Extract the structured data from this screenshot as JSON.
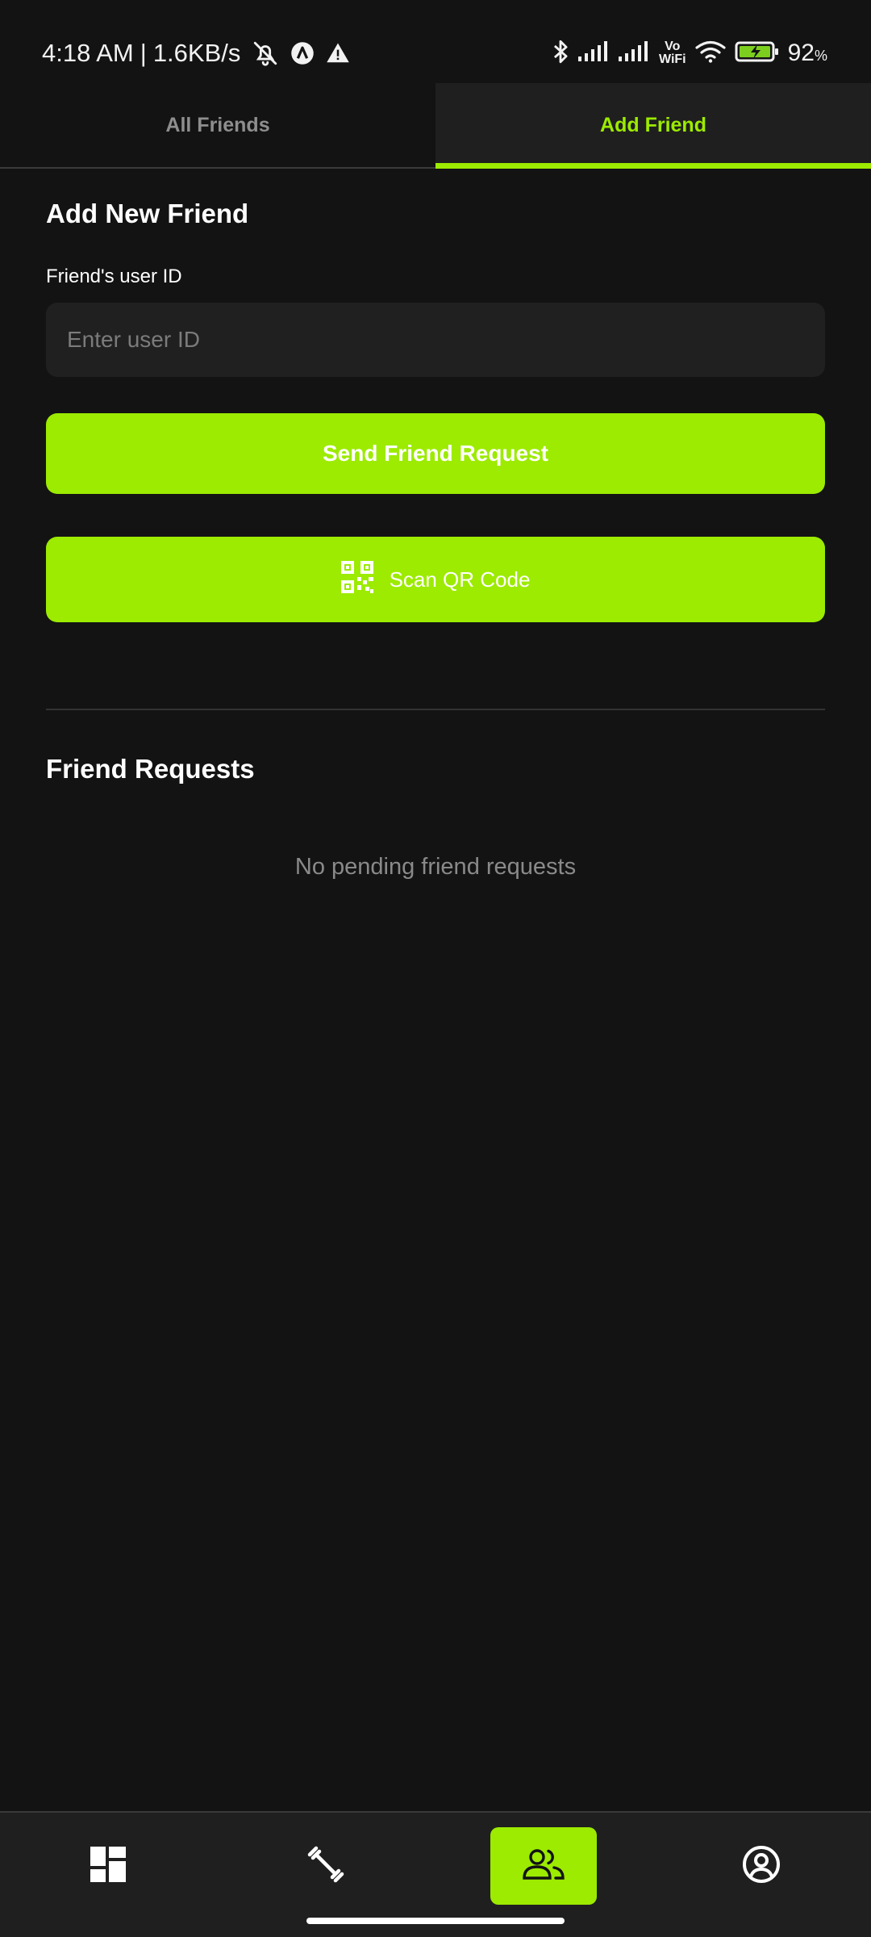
{
  "status_bar": {
    "time": "4:18 AM",
    "separator": "|",
    "speed": "1.6KB/s",
    "vowifi_top": "Vo",
    "vowifi_bottom": "WiFi",
    "battery_percent": "92",
    "battery_unit": "%",
    "icons": [
      "bell-off-icon",
      "app-a-icon",
      "warning-icon",
      "bluetooth-icon",
      "signal-icon",
      "signal-icon",
      "wifi-icon",
      "battery-charging-icon"
    ]
  },
  "tabs": [
    {
      "label": "All Friends",
      "active": false
    },
    {
      "label": "Add Friend",
      "active": true
    }
  ],
  "add_friend": {
    "title": "Add New Friend",
    "field_label": "Friend's user ID",
    "input_placeholder": "Enter user ID",
    "input_value": "",
    "send_button_label": "Send Friend Request",
    "scan_button_label": "Scan QR Code",
    "scan_icon": "qr-code-icon"
  },
  "friend_requests": {
    "title": "Friend Requests",
    "empty_text": "No pending friend requests"
  },
  "bottom_nav": {
    "items": [
      {
        "icon": "dashboard-icon",
        "active": false
      },
      {
        "icon": "dumbbell-icon",
        "active": false
      },
      {
        "icon": "friends-icon",
        "active": true
      },
      {
        "icon": "profile-icon",
        "active": false
      }
    ]
  },
  "colors": {
    "accent": "#9ceb00",
    "background": "#131313",
    "surface": "#1f1f1f",
    "muted_text": "#8a8a8a"
  }
}
